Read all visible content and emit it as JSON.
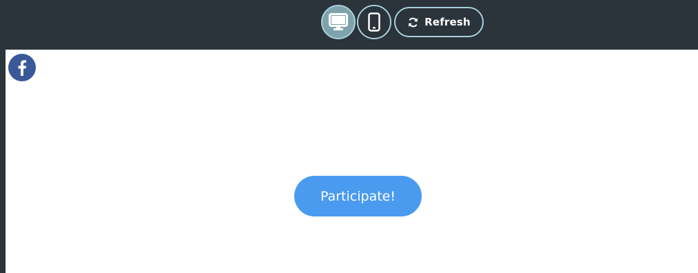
{
  "toolbar": {
    "desktop_icon": "desktop-monitor-icon",
    "mobile_icon": "mobile-phone-icon",
    "refresh_icon": "refresh-arrows-icon",
    "refresh_label": "Refresh",
    "active_view": "desktop"
  },
  "preview": {
    "social_icon": "facebook-icon",
    "cta_label": "Participate!"
  },
  "colors": {
    "toolbar_bg": "#2b333b",
    "button_border": "#a9d1dc",
    "active_button_bg": "#7fa3ad",
    "facebook_blue": "#3b5998",
    "cta_blue": "#4a9bf0"
  }
}
